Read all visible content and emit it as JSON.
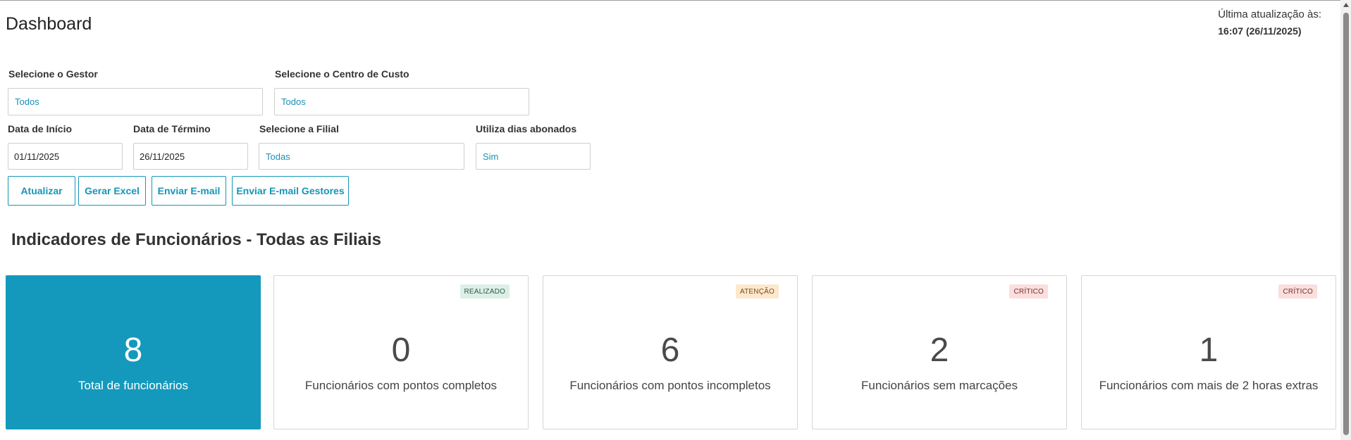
{
  "header": {
    "title": "Dashboard",
    "last_update_label": "Última atualização às:",
    "last_update_value": "16:07 (26/11/2025)"
  },
  "filters": {
    "gestor": {
      "label": "Selecione o Gestor",
      "value": "Todos"
    },
    "centro_custo": {
      "label": "Selecione o Centro de Custo",
      "value": "Todos"
    },
    "data_inicio": {
      "label": "Data de Início",
      "value": "01/11/2025"
    },
    "data_termino": {
      "label": "Data de Término",
      "value": "26/11/2025"
    },
    "filial": {
      "label": "Selecione a Filial",
      "value": "Todas"
    },
    "dias_abonados": {
      "label": "Utiliza dias abonados",
      "value": "Sim"
    }
  },
  "actions": {
    "atualizar": "Atualizar",
    "gerar_excel": "Gerar Excel",
    "enviar_email": "Enviar E-mail",
    "enviar_email_gestores": "Enviar E-mail Gestores"
  },
  "section": {
    "title": "Indicadores de Funcionários - Todas as Filiais"
  },
  "cards": [
    {
      "value": "8",
      "label": "Total de funcionários",
      "badge": ""
    },
    {
      "value": "0",
      "label": "Funcionários com pontos completos",
      "badge": "REALIZADO"
    },
    {
      "value": "6",
      "label": "Funcionários com pontos incompletos",
      "badge": "ATENÇÃO"
    },
    {
      "value": "2",
      "label": "Funcionários sem marcações",
      "badge": "CRÍTICO"
    },
    {
      "value": "1",
      "label": "Funcionários com mais de 2 horas extras",
      "badge": "CRÍTICO"
    }
  ],
  "colors": {
    "accent": "#1499bc",
    "badge_ok": "#dcefe7",
    "badge_warn": "#fde8cd",
    "badge_crit": "#fbdede"
  }
}
